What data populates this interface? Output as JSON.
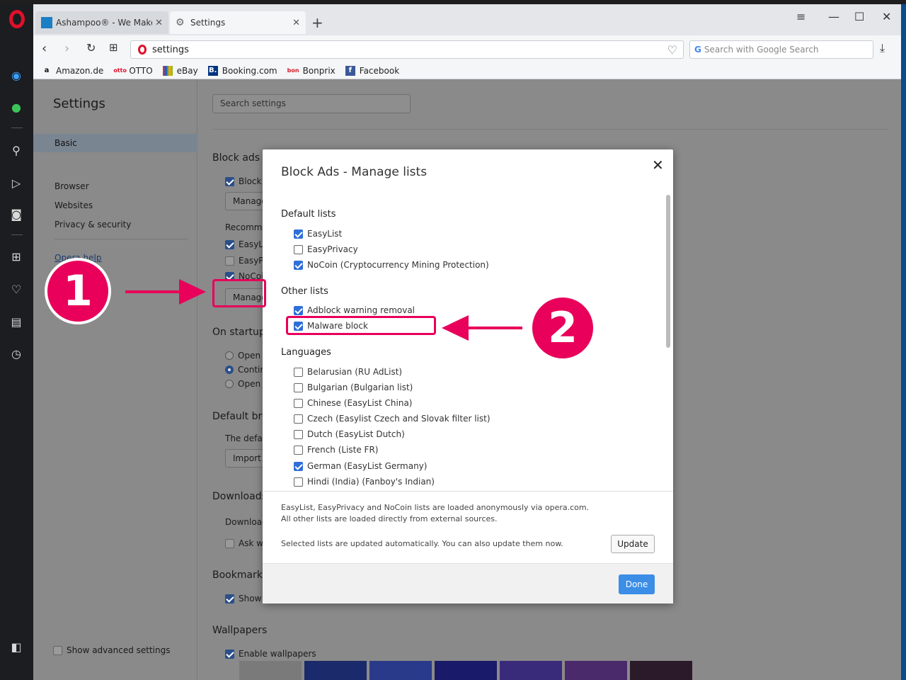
{
  "tabs": [
    {
      "label": "Ashampoo® - We Make S",
      "close": "✕"
    },
    {
      "label": "Settings",
      "close": "✕"
    }
  ],
  "new_tab": "+",
  "address": {
    "url": "settings",
    "search_placeholder": "Search with Google Search",
    "search_logo": "G"
  },
  "bookmarks": [
    {
      "label": "Amazon.de",
      "icon": "a"
    },
    {
      "label": "OTTO",
      "icon": "otto"
    },
    {
      "label": "eBay",
      "icon": "ebay-icon"
    },
    {
      "label": "Booking.com",
      "icon": "B."
    },
    {
      "label": "Bonprix",
      "icon": "bon"
    },
    {
      "label": "Facebook",
      "icon": "f"
    }
  ],
  "settings": {
    "title": "Settings",
    "nav": {
      "basic": "Basic",
      "browser": "Browser",
      "websites": "Websites",
      "privacy": "Privacy & security",
      "help": "Opera help",
      "advanced": "Show advanced settings"
    },
    "search_placeholder": "Search settings",
    "block_ads": {
      "heading": "Block ads",
      "block_label": "Block a",
      "manage": "Manage",
      "recommended": "Recomme",
      "list1": "EasyLis",
      "list2": "EasyPr",
      "list3": "NoCoi",
      "manage2": "Manage"
    },
    "startup": {
      "heading": "On startup",
      "opt1": "Open t",
      "opt2": "Contin",
      "opt3": "Open a"
    },
    "default_browser": {
      "heading": "Default bro",
      "text": "The defau",
      "import": "Import b"
    },
    "downloads": {
      "heading": "Downloads",
      "text": "Download",
      "ask": "Ask wh"
    },
    "bookmarks": {
      "heading": "Bookmarks",
      "show": "Show t"
    },
    "wallpapers": {
      "heading": "Wallpapers",
      "enable": "Enable wallpapers"
    }
  },
  "modal": {
    "title": "Block Ads - Manage lists",
    "close": "✕",
    "default_heading": "Default lists",
    "default_lists": [
      {
        "label": "EasyList",
        "checked": true
      },
      {
        "label": "EasyPrivacy",
        "checked": false
      },
      {
        "label": "NoCoin (Cryptocurrency Mining Protection)",
        "checked": true
      }
    ],
    "other_heading": "Other lists",
    "other_lists": [
      {
        "label": "Adblock warning removal",
        "checked": true
      },
      {
        "label": "Malware block",
        "checked": true
      }
    ],
    "lang_heading": "Languages",
    "languages": [
      {
        "label": "Belarusian (RU AdList)",
        "checked": false
      },
      {
        "label": "Bulgarian (Bulgarian list)",
        "checked": false
      },
      {
        "label": "Chinese (EasyList China)",
        "checked": false
      },
      {
        "label": "Czech (Easylist Czech and Slovak filter list)",
        "checked": false
      },
      {
        "label": "Dutch (EasyList Dutch)",
        "checked": false
      },
      {
        "label": "French (Liste FR)",
        "checked": false
      },
      {
        "label": "German (EasyList Germany)",
        "checked": true
      },
      {
        "label": "Hindi (India) (Fanboy's Indian)",
        "checked": false
      }
    ],
    "foot_line1": "EasyList, EasyPrivacy and NoCoin lists are loaded anonymously via opera.com.",
    "foot_line2": "All other lists are loaded directly from external sources.",
    "foot_line3": "Selected lists are updated automatically. You can also update them now.",
    "update": "Update",
    "done": "Done"
  },
  "annotations": {
    "one": "1",
    "two": "2"
  },
  "colors": {
    "accent": "#3b8de6",
    "annotation": "#e8005a",
    "opera_red": "#e0102a"
  }
}
